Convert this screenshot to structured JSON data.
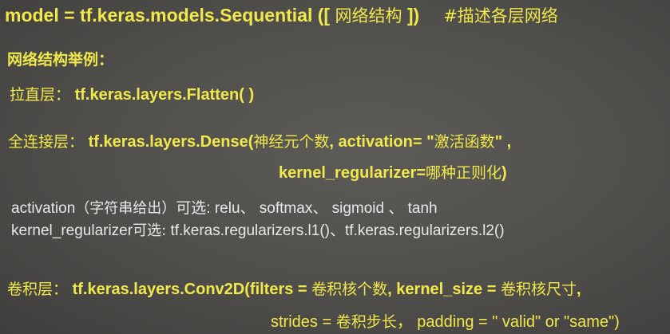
{
  "slide": {
    "line1": {
      "code": "model = tf.keras.models.Sequential ([",
      "arg": "网络结构",
      "close": "])",
      "comment": "#描述各层网络"
    },
    "heading": "网络结构举例：",
    "flatten": {
      "label": "拉直层：",
      "code": "tf.keras.layers.Flatten( )"
    },
    "dense": {
      "label": "全连接层：",
      "code_a": "tf.keras.layers.Dense(",
      "arg_a": "神经元个数",
      "code_b": ", activation= \"",
      "arg_b": "激活函数",
      "code_c": "\" ,",
      "line2_code": "kernel_regularizer=",
      "line2_arg": "哪种正则化",
      "line2_close": ")"
    },
    "activation_note": {
      "pre": "activation",
      "paren": "（字符串给出）",
      "mid": "可选: relu、 softmax、 sigmoid 、 tanh"
    },
    "regularizer_note": {
      "pre": "kernel_regularizer",
      "mid": "可选:",
      "post": "tf.keras.regularizers.l1()、tf.keras.regularizers.l2()"
    },
    "conv": {
      "label": "卷积层：",
      "code_a": "tf.keras.layers.Conv2D(filters =",
      "arg_a": "卷积核个数",
      "code_b": ", kernel_size =",
      "arg_b": "卷积核尺寸",
      "code_c": ",",
      "line2_a": "strides =",
      "line2_arg": "卷积步长",
      "line2_b": "， padding = \" valid\" or \"same\")"
    }
  }
}
